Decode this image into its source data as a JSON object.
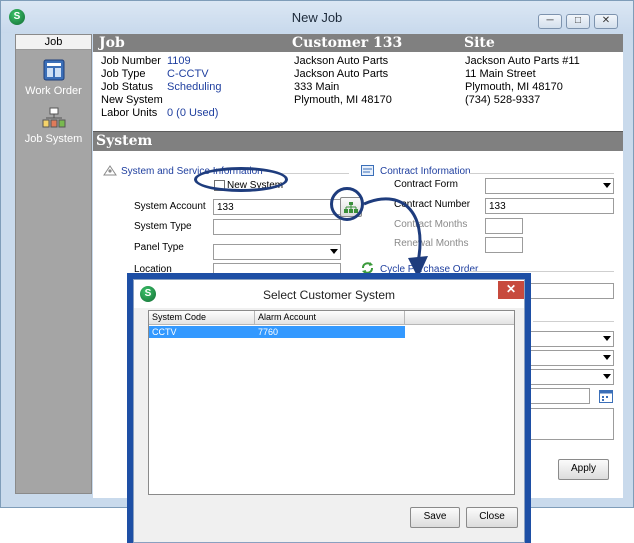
{
  "window": {
    "title": "New Job"
  },
  "nav": {
    "header": "Job",
    "items": [
      {
        "label": "Work Order",
        "icon": "work-order-icon"
      },
      {
        "label": "Job System",
        "icon": "job-system-icon"
      }
    ]
  },
  "job": {
    "heading": "Job",
    "rows": [
      {
        "label": "Job Number",
        "value": "1109"
      },
      {
        "label": "Job Type",
        "value": "C-CCTV"
      },
      {
        "label": "Job Status",
        "value": "Scheduling"
      },
      {
        "label": "New System",
        "value": ""
      },
      {
        "label": "Labor Units",
        "value": "0 (0 Used)"
      }
    ]
  },
  "customer": {
    "heading": "Customer 133",
    "lines": [
      "Jackson Auto Parts",
      "Jackson Auto Parts",
      "333 Main",
      "Plymouth, MI 48170"
    ]
  },
  "site": {
    "heading": "Site",
    "lines": [
      "Jackson Auto Parts #11",
      "11 Main Street",
      "Plymouth, MI 48170",
      "(734) 528-9337"
    ]
  },
  "system": {
    "heading": "System",
    "service_section": "System and Service Information",
    "new_system_label": "New System",
    "system_account_label": "System Account",
    "system_account_value": "133",
    "system_type_label": "System Type",
    "panel_type_label": "Panel Type",
    "location_label": "Location",
    "contract_section": "Contract Information",
    "contract_form_label": "Contract Form",
    "contract_number_label": "Contract Number",
    "contract_number_value": "133",
    "contract_months_label": "Contract Months",
    "renewal_months_label": "Renewal Months",
    "cycle_section": "Cycle Purchase Order",
    "apply_label": "Apply"
  },
  "dialog": {
    "title": "Select Customer System",
    "columns": [
      "System Code",
      "Alarm Account"
    ],
    "rows": [
      {
        "system_code": "CCTV",
        "alarm_account": "7760"
      }
    ],
    "save_label": "Save",
    "close_label": "Close"
  },
  "colors": {
    "header_band": "#808080",
    "link_blue": "#1f3f9f",
    "selection": "#3399ff",
    "callout": "#1e3c7d",
    "dialog_frame": "#1e4fa5"
  }
}
